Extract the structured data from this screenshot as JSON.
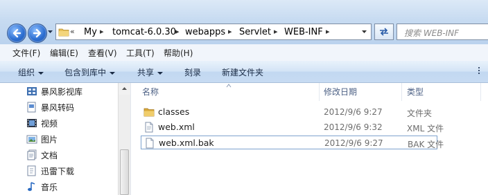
{
  "address": {
    "overflow": "«",
    "crumbs": [
      "My",
      "tomcat-6.0.30",
      "webapps",
      "Servlet",
      "WEB-INF"
    ],
    "search_placeholder": "搜索 WEB-INF"
  },
  "menu": [
    "文件(F)",
    "编辑(E)",
    "查看(V)",
    "工具(T)",
    "帮助(H)"
  ],
  "commands": {
    "organize": "组织",
    "include_in_library": "包含到库中",
    "share": "共享",
    "burn": "刻录",
    "new_folder": "新建文件夹"
  },
  "nav": [
    {
      "label": "暴风影视库",
      "icon": "library-icon"
    },
    {
      "label": "暴风转码",
      "icon": "document-icon"
    },
    {
      "label": "视频",
      "icon": "video-icon"
    },
    {
      "label": "图片",
      "icon": "picture-icon"
    },
    {
      "label": "文档",
      "icon": "documents-icon"
    },
    {
      "label": "迅雷下载",
      "icon": "download-icon"
    },
    {
      "label": "音乐",
      "icon": "music-icon"
    }
  ],
  "columns": {
    "name": "名称",
    "modified": "修改日期",
    "type": "类型"
  },
  "files": [
    {
      "name": "classes",
      "modified": "2012/9/6 9:27",
      "type": "文件夹",
      "icon": "folder-icon"
    },
    {
      "name": "web.xml",
      "modified": "2012/9/6 9:32",
      "type": "XML 文件",
      "icon": "file-icon"
    },
    {
      "name": "web.xml.bak",
      "modified": "2012/9/6 9:27",
      "type": "BAK 文件",
      "icon": "file-icon"
    }
  ],
  "colors": {
    "accent": "#2d6fd2",
    "header_text": "#4d6185",
    "selection_border": "#7da2ce"
  }
}
